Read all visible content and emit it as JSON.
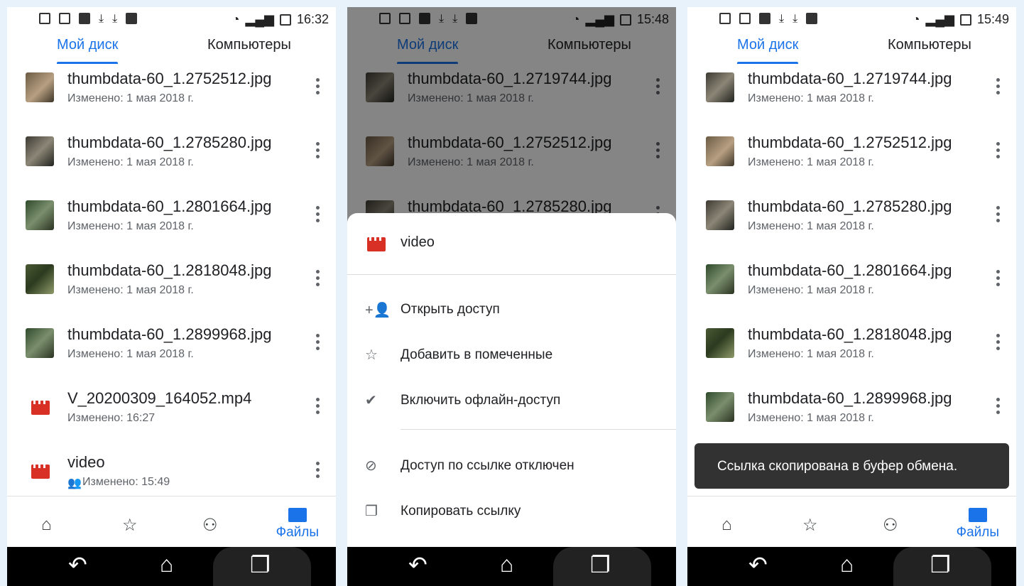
{
  "panels": [
    {
      "time": "16:32",
      "tabs": [
        "Мой диск",
        "Компьютеры"
      ],
      "files": [
        {
          "name": "thumbdata-60_1.2752512.jpg",
          "meta": "Изменено: 1 мая 2018 г.",
          "type": "image"
        },
        {
          "name": "thumbdata-60_1.2785280.jpg",
          "meta": "Изменено: 1 мая 2018 г.",
          "type": "image"
        },
        {
          "name": "thumbdata-60_1.2801664.jpg",
          "meta": "Изменено: 1 мая 2018 г.",
          "type": "image"
        },
        {
          "name": "thumbdata-60_1.2818048.jpg",
          "meta": "Изменено: 1 мая 2018 г.",
          "type": "image"
        },
        {
          "name": "thumbdata-60_1.2899968.jpg",
          "meta": "Изменено: 1 мая 2018 г.",
          "type": "image"
        },
        {
          "name": "V_20200309_164052.mp4",
          "meta": "Изменено: 16:27",
          "type": "video"
        },
        {
          "name": "video",
          "meta": "Изменено: 15:49",
          "type": "video",
          "shared_icon": "people-icon"
        }
      ],
      "nav_files_label": "Файлы"
    },
    {
      "time": "15:48",
      "tabs": [
        "Мой диск",
        "Компьютеры"
      ],
      "files": [
        {
          "name": "thumbdata-60_1.2719744.jpg",
          "meta": "Изменено: 1 мая 2018 г."
        },
        {
          "name": "thumbdata-60_1.2752512.jpg",
          "meta": "Изменено: 1 мая 2018 г."
        },
        {
          "name": "thumbdata-60_1.2785280.jpg",
          "meta": ""
        }
      ],
      "sheet": {
        "title": "video",
        "items": [
          {
            "label": "Открыть доступ",
            "icon": "person-add-icon"
          },
          {
            "label": "Добавить в помеченные",
            "icon": "star-outline-icon"
          },
          {
            "label": "Включить офлайн-доступ",
            "icon": "offline-check-icon"
          },
          {
            "label": "Доступ по ссылке отключен",
            "icon": "link-off-icon"
          },
          {
            "label": "Копировать ссылку",
            "icon": "copy-icon"
          }
        ]
      }
    },
    {
      "time": "15:49",
      "tabs": [
        "Мой диск",
        "Компьютеры"
      ],
      "files": [
        {
          "name": "thumbdata-60_1.2719744.jpg",
          "meta": "Изменено: 1 мая 2018 г."
        },
        {
          "name": "thumbdata-60_1.2752512.jpg",
          "meta": "Изменено: 1 мая 2018 г."
        },
        {
          "name": "thumbdata-60_1.2785280.jpg",
          "meta": "Изменено: 1 мая 2018 г."
        },
        {
          "name": "thumbdata-60_1.2801664.jpg",
          "meta": "Изменено: 1 мая 2018 г."
        },
        {
          "name": "thumbdata-60_1.2818048.jpg",
          "meta": "Изменено: 1 мая 2018 г."
        },
        {
          "name": "thumbdata-60_1.2899968.jpg",
          "meta": "Изменено: 1 мая 2018 г."
        }
      ],
      "toast": "Ссылка скопирована в буфер обмена.",
      "nav_files_label": "Файлы"
    }
  ],
  "colors": {
    "accent": "#1a73e8",
    "video_red": "#d93025",
    "toast_bg": "#323232"
  }
}
